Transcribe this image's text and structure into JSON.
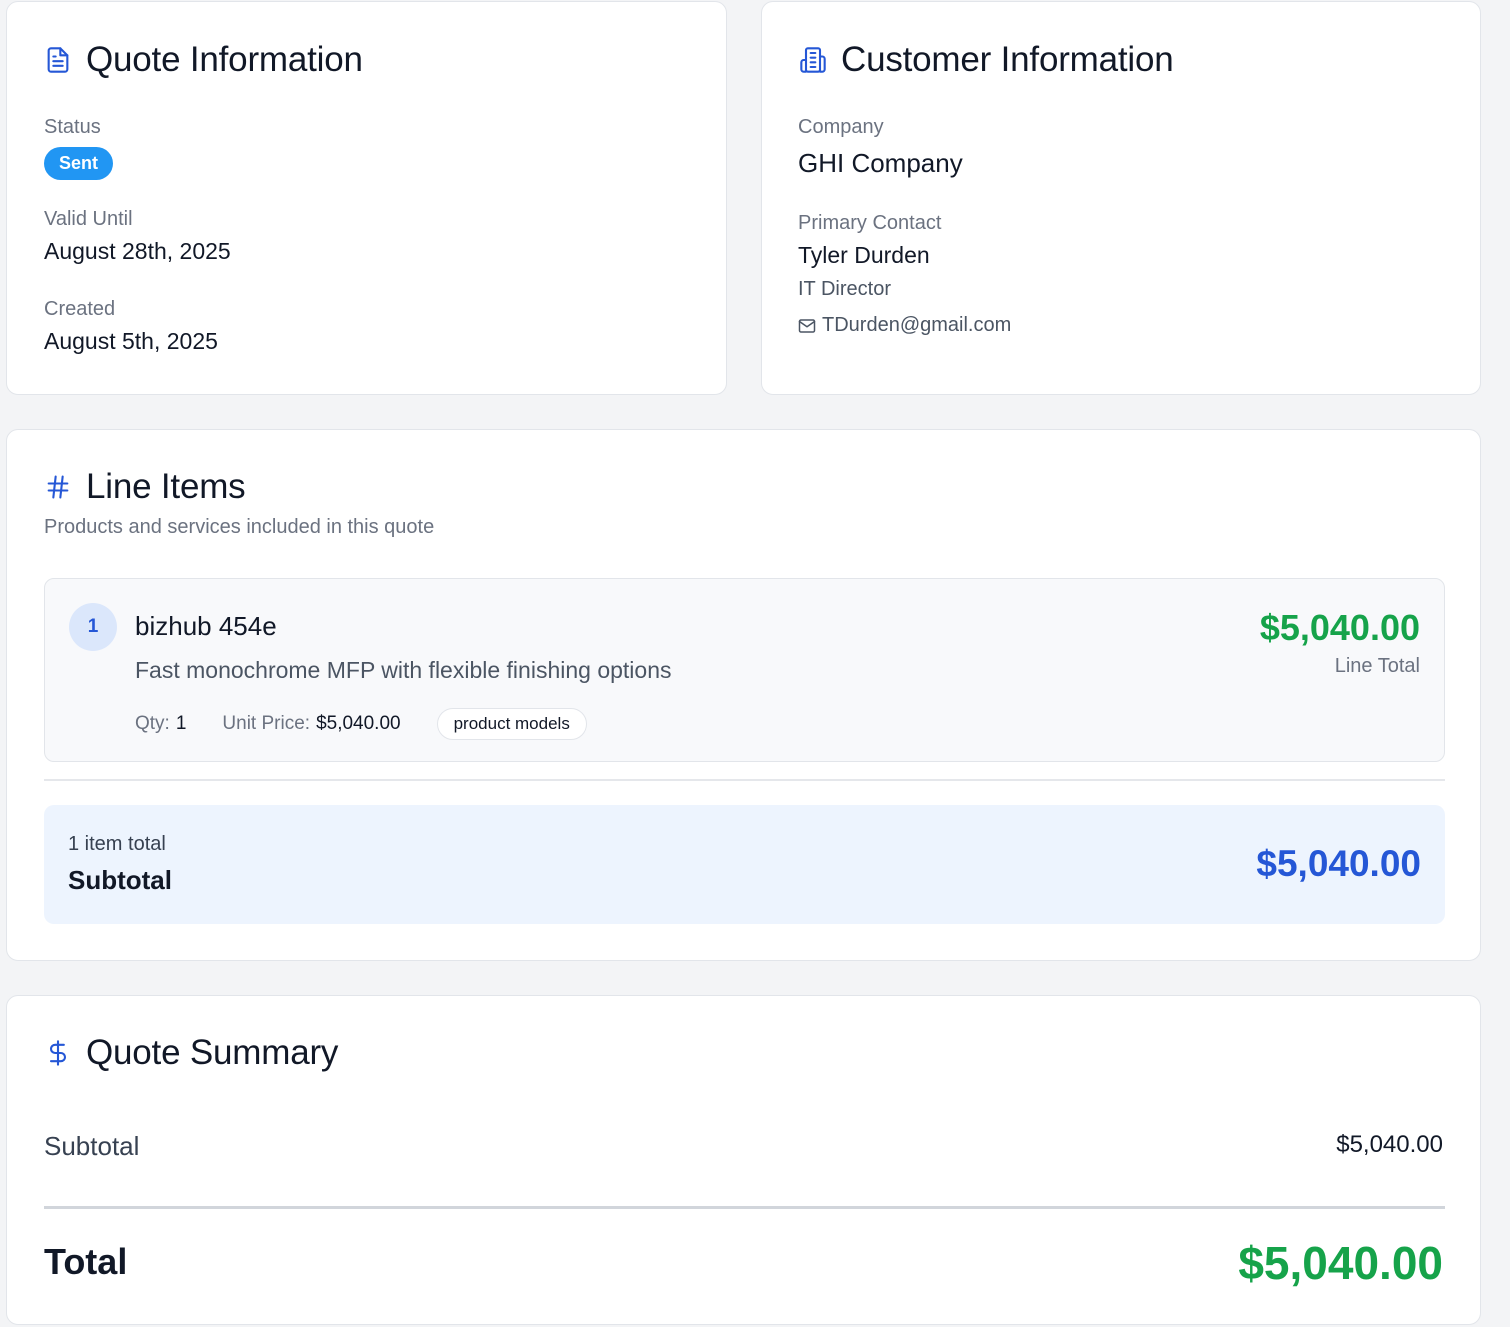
{
  "quote_info": {
    "title": "Quote Information",
    "icon": "document-icon",
    "status_label": "Status",
    "status_value": "Sent",
    "valid_until_label": "Valid Until",
    "valid_until_value": "August 28th, 2025",
    "created_label": "Created",
    "created_value": "August 5th, 2025"
  },
  "customer_info": {
    "title": "Customer Information",
    "icon": "building-icon",
    "company_label": "Company",
    "company_value": "GHI Company",
    "contact_label": "Primary Contact",
    "contact_name": "Tyler Durden",
    "contact_title": "IT Director",
    "contact_email": "TDurden@gmail.com"
  },
  "line_items": {
    "title": "Line Items",
    "icon": "hash-icon",
    "subtitle": "Products and services included in this quote",
    "items": [
      {
        "number": "1",
        "name": "bizhub 454e",
        "description": "Fast monochrome MFP with flexible finishing options",
        "qty_label": "Qty:",
        "qty_value": "1",
        "unit_price_label": "Unit Price:",
        "unit_price_value": "$5,040.00",
        "tag": "product models",
        "line_total": "$5,040.00",
        "line_total_label": "Line Total"
      }
    ],
    "subtotal_count": "1 item total",
    "subtotal_label": "Subtotal",
    "subtotal_amount": "$5,040.00"
  },
  "summary": {
    "title": "Quote Summary",
    "icon": "dollar-icon",
    "subtotal_label": "Subtotal",
    "subtotal_value": "$5,040.00",
    "total_label": "Total",
    "total_value": "$5,040.00"
  },
  "colors": {
    "accent_blue": "#2557d6",
    "status_blue": "#2196f3",
    "money_green": "#16a34a"
  }
}
